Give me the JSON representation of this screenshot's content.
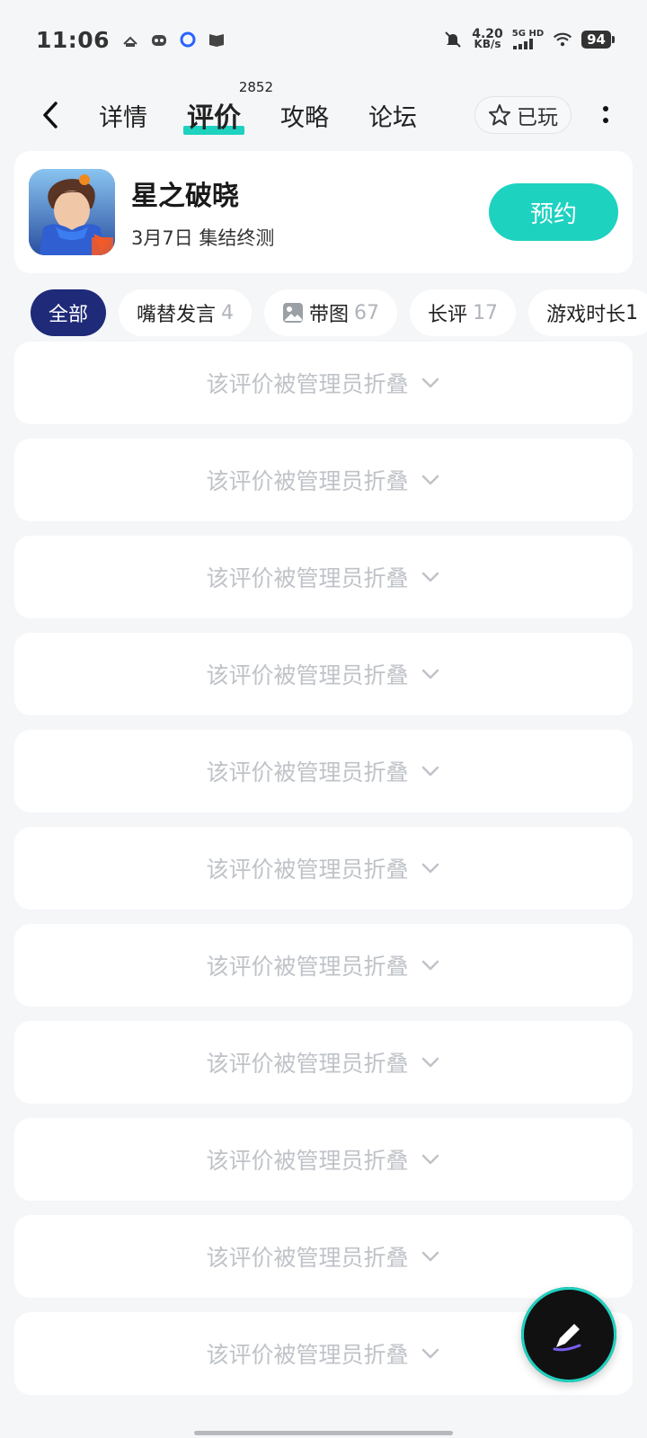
{
  "status_bar": {
    "time": "11:06",
    "net_speed_value": "4.20",
    "net_speed_unit": "KB/s",
    "signal_label": "5G HD",
    "battery": "94",
    "icons": [
      "hotspot-icon",
      "robot-icon",
      "circle-app-icon",
      "book-icon",
      "mute-bell-icon",
      "signal-icon",
      "wifi-icon",
      "battery-icon"
    ]
  },
  "header": {
    "tabs": [
      {
        "label": "详情"
      },
      {
        "label": "评价",
        "count": "2852",
        "active": true
      },
      {
        "label": "攻略"
      },
      {
        "label": "论坛"
      }
    ],
    "played_label": "已玩"
  },
  "game": {
    "title": "星之破晓",
    "subtitle": "3月7日 集结终测",
    "reserve_label": "预约"
  },
  "filters": [
    {
      "label": "全部",
      "count": "",
      "active": true
    },
    {
      "label": "嘴替发言",
      "count": "4"
    },
    {
      "label": "带图",
      "count": "67",
      "icon": "image-icon"
    },
    {
      "label": "长评",
      "count": "17"
    },
    {
      "label": "游戏时长",
      "count": "1"
    }
  ],
  "reviews": {
    "collapsed_text": "该评价被管理员折叠",
    "items": [
      {
        "text": "该评价被管理员折叠"
      },
      {
        "text": "该评价被管理员折叠"
      },
      {
        "text": "该评价被管理员折叠"
      },
      {
        "text": "该评价被管理员折叠"
      },
      {
        "text": "该评价被管理员折叠"
      },
      {
        "text": "该评价被管理员折叠"
      },
      {
        "text": "该评价被管理员折叠"
      },
      {
        "text": "该评价被管理员折叠"
      },
      {
        "text": "该评价被管理员折叠"
      },
      {
        "text": "该评价被管理员折叠"
      },
      {
        "text": "该评价被管理员折叠"
      }
    ]
  },
  "colors": {
    "accent": "#1ed2c0",
    "chip_active": "#1f2a78",
    "background": "#f4f6f8",
    "collapsed_text": "#bfc3c8"
  }
}
